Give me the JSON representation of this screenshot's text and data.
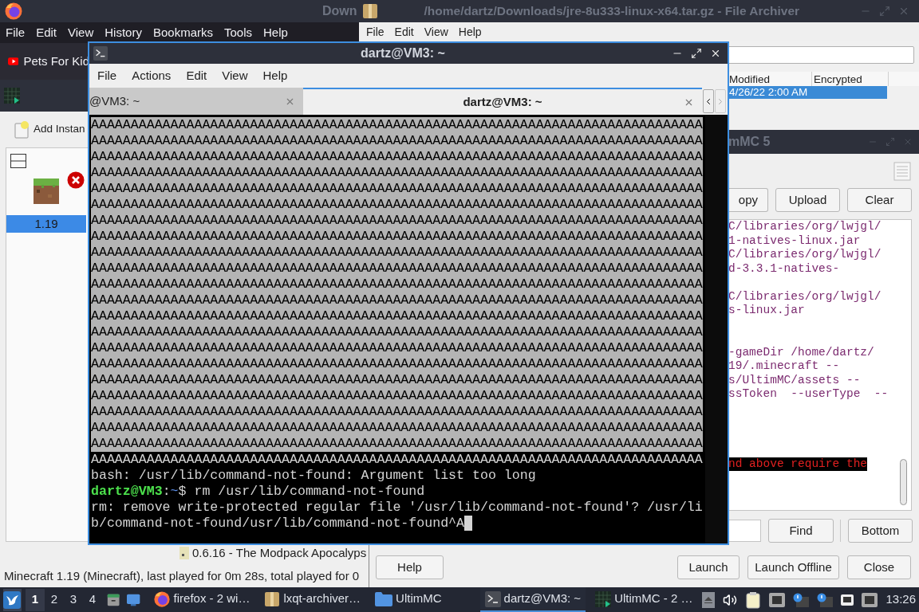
{
  "top_bar": {
    "firefox_title": "Down",
    "archiver_title": "/home/dartz/Downloads/jre-8u333-linux-x64.tar.gz - File Archiver"
  },
  "firefox": {
    "menu": [
      "File",
      "Edit",
      "View",
      "History",
      "Bookmarks",
      "Tools",
      "Help"
    ],
    "bookmark": "Pets For Kid"
  },
  "archiver": {
    "menu": [
      "File",
      "Edit",
      "View",
      "Help"
    ],
    "columns": [
      "Modified",
      "Encrypted"
    ],
    "rows": [
      {
        "modified": "4/26/22 2:00 AM",
        "selected": true
      }
    ]
  },
  "ultimmc": {
    "toolbar_button": "Add Instan",
    "instances": [
      {
        "name": "1.19",
        "selected": true,
        "error": true
      }
    ],
    "news": "0.6.16 - The Modpack Apocalyps",
    "status": "Minecraft 1.19 (Minecraft), last played for 0m 28s, total played for 0"
  },
  "log_window": {
    "title": "mMC 5",
    "buttons": [
      "opy",
      "Upload",
      "Clear"
    ],
    "log": [
      {
        "kind": "text",
        "text": "C/libraries/org/lwjgl/"
      },
      {
        "kind": "text",
        "text": "1-natives-linux.jar"
      },
      {
        "kind": "text",
        "text": "C/libraries/org/lwjgl/"
      },
      {
        "kind": "text",
        "text": "d-3.3.1-natives-"
      },
      {
        "kind": "blank"
      },
      {
        "kind": "text",
        "text": "C/libraries/org/lwjgl/"
      },
      {
        "kind": "text",
        "text": "s-linux.jar"
      },
      {
        "kind": "blank"
      },
      {
        "kind": "blank"
      },
      {
        "kind": "text",
        "text": "-gameDir /home/dartz/"
      },
      {
        "kind": "text",
        "text": "19/.minecraft --"
      },
      {
        "kind": "text",
        "text": "s/UltimMC/assets --"
      },
      {
        "kind": "text",
        "text": "ssToken  --userType  --"
      },
      {
        "kind": "blank"
      },
      {
        "kind": "blank"
      },
      {
        "kind": "blank"
      },
      {
        "kind": "blank"
      },
      {
        "kind": "error",
        "text": "nd above require the"
      }
    ],
    "find_button": "Find",
    "bottom_button": "Bottom",
    "help_button": "Help",
    "action_buttons": [
      "Launch",
      "Launch Offline",
      "Close"
    ]
  },
  "terminal": {
    "title": "dartz@VM3: ~",
    "menu": [
      "File",
      "Actions",
      "Edit",
      "View",
      "Help"
    ],
    "tabs": [
      {
        "label": "@VM3: ~",
        "selected": false
      },
      {
        "label": "dartz@VM3: ~",
        "selected": true
      }
    ],
    "lines": [
      {
        "kind": "output",
        "text": "AAAAAAAAAAAAAAAAAAAAAAAAAAAAAAAAAAAAAAAAAAAAAAAAAAAAAAAAAAAAAAAAAAAAAAAAAAAAA",
        "selected": true
      },
      {
        "kind": "output",
        "text": "AAAAAAAAAAAAAAAAAAAAAAAAAAAAAAAAAAAAAAAAAAAAAAAAAAAAAAAAAAAAAAAAAAAAAAAAAAAAA",
        "selected": true
      },
      {
        "kind": "output",
        "text": "AAAAAAAAAAAAAAAAAAAAAAAAAAAAAAAAAAAAAAAAAAAAAAAAAAAAAAAAAAAAAAAAAAAAAAAAAAAAA",
        "selected": true
      },
      {
        "kind": "output",
        "text": "AAAAAAAAAAAAAAAAAAAAAAAAAAAAAAAAAAAAAAAAAAAAAAAAAAAAAAAAAAAAAAAAAAAAAAAAAAAAA",
        "selected": true
      },
      {
        "kind": "output",
        "text": "AAAAAAAAAAAAAAAAAAAAAAAAAAAAAAAAAAAAAAAAAAAAAAAAAAAAAAAAAAAAAAAAAAAAAAAAAAAAA",
        "selected": true
      },
      {
        "kind": "output",
        "text": "AAAAAAAAAAAAAAAAAAAAAAAAAAAAAAAAAAAAAAAAAAAAAAAAAAAAAAAAAAAAAAAAAAAAAAAAAAAAA",
        "selected": true
      },
      {
        "kind": "output",
        "text": "AAAAAAAAAAAAAAAAAAAAAAAAAAAAAAAAAAAAAAAAAAAAAAAAAAAAAAAAAAAAAAAAAAAAAAAAAAAAA",
        "selected": true
      },
      {
        "kind": "output",
        "text": "AAAAAAAAAAAAAAAAAAAAAAAAAAAAAAAAAAAAAAAAAAAAAAAAAAAAAAAAAAAAAAAAAAAAAAAAAAAAA",
        "selected": true
      },
      {
        "kind": "output",
        "text": "AAAAAAAAAAAAAAAAAAAAAAAAAAAAAAAAAAAAAAAAAAAAAAAAAAAAAAAAAAAAAAAAAAAAAAAAAAAAA",
        "selected": true
      },
      {
        "kind": "output",
        "text": "AAAAAAAAAAAAAAAAAAAAAAAAAAAAAAAAAAAAAAAAAAAAAAAAAAAAAAAAAAAAAAAAAAAAAAAAAAAAA",
        "selected": true
      },
      {
        "kind": "output",
        "text": "AAAAAAAAAAAAAAAAAAAAAAAAAAAAAAAAAAAAAAAAAAAAAAAAAAAAAAAAAAAAAAAAAAAAAAAAAAAAA",
        "selected": true
      },
      {
        "kind": "output",
        "text": "AAAAAAAAAAAAAAAAAAAAAAAAAAAAAAAAAAAAAAAAAAAAAAAAAAAAAAAAAAAAAAAAAAAAAAAAAAAAA",
        "selected": true
      },
      {
        "kind": "output",
        "text": "AAAAAAAAAAAAAAAAAAAAAAAAAAAAAAAAAAAAAAAAAAAAAAAAAAAAAAAAAAAAAAAAAAAAAAAAAAAAA",
        "selected": true
      },
      {
        "kind": "output",
        "text": "AAAAAAAAAAAAAAAAAAAAAAAAAAAAAAAAAAAAAAAAAAAAAAAAAAAAAAAAAAAAAAAAAAAAAAAAAAAAA",
        "selected": true
      },
      {
        "kind": "output",
        "text": "AAAAAAAAAAAAAAAAAAAAAAAAAAAAAAAAAAAAAAAAAAAAAAAAAAAAAAAAAAAAAAAAAAAAAAAAAAAAA",
        "selected": true
      },
      {
        "kind": "output",
        "text": "AAAAAAAAAAAAAAAAAAAAAAAAAAAAAAAAAAAAAAAAAAAAAAAAAAAAAAAAAAAAAAAAAAAAAAAAAAAAA",
        "selected": true
      },
      {
        "kind": "output",
        "text": "AAAAAAAAAAAAAAAAAAAAAAAAAAAAAAAAAAAAAAAAAAAAAAAAAAAAAAAAAAAAAAAAAAAAAAAAAAAAA",
        "selected": true
      },
      {
        "kind": "output",
        "text": "AAAAAAAAAAAAAAAAAAAAAAAAAAAAAAAAAAAAAAAAAAAAAAAAAAAAAAAAAAAAAAAAAAAAAAAAAAAAA",
        "selected": true
      },
      {
        "kind": "output",
        "text": "AAAAAAAAAAAAAAAAAAAAAAAAAAAAAAAAAAAAAAAAAAAAAAAAAAAAAAAAAAAAAAAAAAAAAAAAAAAAA",
        "selected": true
      },
      {
        "kind": "output",
        "text": "AAAAAAAAAAAAAAAAAAAAAAAAAAAAAAAAAAAAAAAAAAAAAAAAAAAAAAAAAAAAAAAAAAAAAAAAAAAAA",
        "selected": true
      },
      {
        "kind": "output",
        "text": "AAAAAAAAAAAAAAAAAAAAAAAAAAAAAAAAAAAAAAAAAAAAAAAAAAAAAAAAAAAAAAAAAAAAAAAAAAAAA",
        "selected": true
      },
      {
        "kind": "output",
        "text": "AAAAAAAAAAAAAAAAAAAAAAAAAAAAAAAAAAAAAAAAAAAAAAAAAAAAAAAAAAAAAAAAAAAAAAAAAAAAA",
        "selected": false
      },
      {
        "kind": "output",
        "text": "bash: /usr/lib/command-not-found: Argument list too long",
        "selected": false
      },
      {
        "kind": "prompt",
        "user": "dartz@VM3",
        "sep": ":",
        "path": "~",
        "tail": "$ rm /usr/lib/command-not-found"
      },
      {
        "kind": "output",
        "text": "rm: remove write-protected regular file '/usr/lib/command-not-found'? /usr/li",
        "selected": false
      },
      {
        "kind": "output",
        "text": "b/command-not-found/usr/lib/command-not-found^A",
        "selected": false,
        "cursor": true
      }
    ]
  },
  "taskbar": {
    "workspaces": [
      {
        "label": "1",
        "selected": true
      },
      {
        "label": "2",
        "selected": false
      },
      {
        "label": "3",
        "selected": false
      },
      {
        "label": "4",
        "selected": false
      }
    ],
    "tasks": [
      {
        "kind": "browser",
        "label": "firefox - 2 wi…",
        "selected": false
      },
      {
        "kind": "archiver",
        "label": "lxqt-archiver…",
        "selected": false
      },
      {
        "kind": "folder",
        "label": "UltimMC",
        "selected": false
      },
      {
        "kind": "terminal",
        "label": "dartz@VM3: ~",
        "selected": true
      },
      {
        "kind": "launcher",
        "label": "UltimMC - 2 …",
        "selected": false
      }
    ],
    "clock": "13:26"
  }
}
